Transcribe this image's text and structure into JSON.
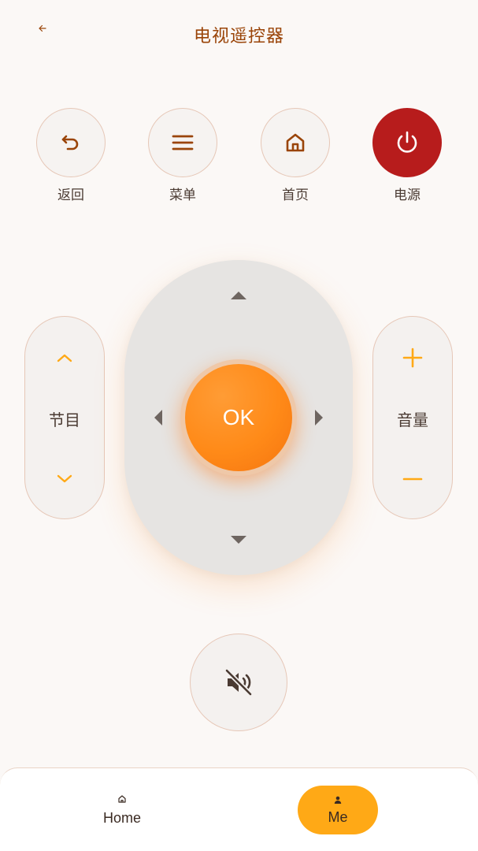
{
  "header": {
    "back_icon": "arrow-left-icon",
    "title": "电视遥控器"
  },
  "top_buttons": [
    {
      "label": "返回",
      "icon": "undo-icon"
    },
    {
      "label": "菜单",
      "icon": "menu-icon"
    },
    {
      "label": "首页",
      "icon": "home-icon"
    },
    {
      "label": "电源",
      "icon": "power-icon"
    }
  ],
  "channel": {
    "label": "节目",
    "up_icon": "chevron-up-icon",
    "down_icon": "chevron-down-icon"
  },
  "volume": {
    "label": "音量",
    "up_icon": "plus-icon",
    "down_icon": "minus-icon"
  },
  "dpad": {
    "ok_label": "OK"
  },
  "mute": {
    "icon": "mute-icon"
  },
  "bottom_nav": {
    "items": [
      {
        "label": "Home",
        "icon": "home-icon",
        "active": false
      },
      {
        "label": "Me",
        "icon": "person-icon",
        "active": true
      }
    ]
  },
  "colors": {
    "accent": "#FF8A18",
    "brand_text": "#9A4408",
    "power": "#B71C1C",
    "nav_active": "#FFA916",
    "background": "#FBF8F6"
  }
}
